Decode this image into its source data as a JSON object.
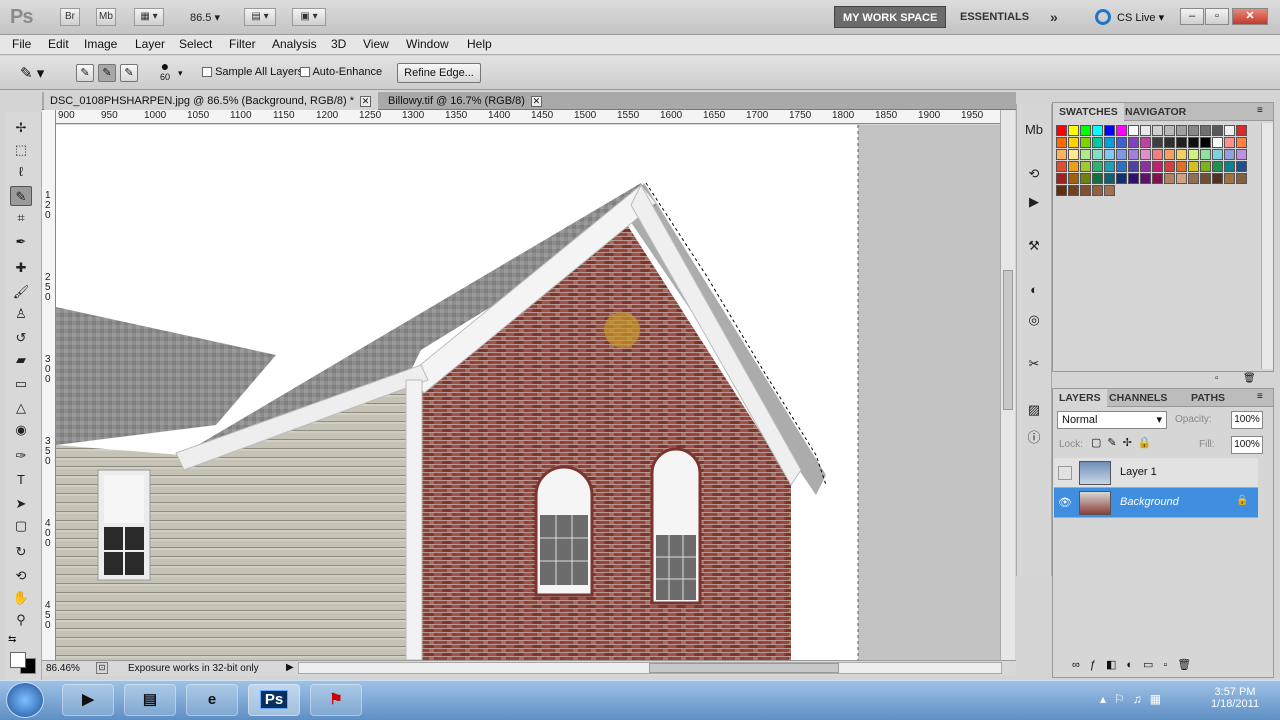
{
  "app": {
    "logo": "Ps",
    "quick_buttons": [
      "Br",
      "Mb"
    ],
    "zoom_value": "86.5",
    "workspaces": [
      "MY WORK SPACE",
      "ESSENTIALS"
    ],
    "more_label": "»",
    "cs_live": "CS Live"
  },
  "menu": [
    "File",
    "Edit",
    "Image",
    "Layer",
    "Select",
    "Filter",
    "Analysis",
    "3D",
    "View",
    "Window",
    "Help"
  ],
  "options": {
    "brush_size": "60",
    "sample_all_layers": "Sample All Layers",
    "auto_enhance": "Auto-Enhance",
    "refine_edge": "Refine Edge..."
  },
  "doc_tabs": [
    {
      "label": "DSC_0108PHSHARPEN.jpg @ 86.5% (Background, RGB/8) *"
    },
    {
      "label": "Billowy.tif @ 16.7% (RGB/8)"
    }
  ],
  "ruler_h": [
    "900",
    "950",
    "1000",
    "1050",
    "1100",
    "1150",
    "1200",
    "1250",
    "1300",
    "1350",
    "1400",
    "1450",
    "1500",
    "1550",
    "1600",
    "1650",
    "1700",
    "1750",
    "1800",
    "1850",
    "1900",
    "1950"
  ],
  "ruler_v": [
    "1",
    "2",
    "0",
    "2",
    "5",
    "0",
    "3",
    "0",
    "0",
    "3",
    "5",
    "0",
    "4",
    "0",
    "0",
    "4",
    "5",
    "0"
  ],
  "status": {
    "zoom": "86.46%",
    "message": "Exposure works in 32-bit only"
  },
  "swatches": {
    "tabs": [
      "SWATCHES",
      "NAVIGATOR"
    ],
    "colors": [
      "#ff0000",
      "#ffff00",
      "#00ff00",
      "#00ffff",
      "#0000ff",
      "#ff00ff",
      "#ffffff",
      "#e8e8e8",
      "#d0d0d0",
      "#b8b8b8",
      "#a0a0a0",
      "#888888",
      "#707070",
      "#585858",
      "#f0f0f0",
      "#d62b2b",
      "#ff6a00",
      "#ffd200",
      "#7fd200",
      "#00c8a0",
      "#00a0e0",
      "#4060d0",
      "#8040c0",
      "#c040a0",
      "#404040",
      "#303030",
      "#202020",
      "#101010",
      "#000000",
      "#f8f8f8",
      "#ff9090",
      "#ff8040",
      "#ffb060",
      "#ffe890",
      "#b0e890",
      "#80e0c0",
      "#80c8f0",
      "#8098e0",
      "#a080d8",
      "#e090c8",
      "#f08080",
      "#f0a060",
      "#f0d060",
      "#d0f080",
      "#90e0a0",
      "#80d0e0",
      "#90a0e0",
      "#c090e0",
      "#e05030",
      "#e8a020",
      "#a0c830",
      "#30b070",
      "#20a0b0",
      "#3070c0",
      "#5040a0",
      "#9030a0",
      "#c02070",
      "#d04040",
      "#e07020",
      "#d0c020",
      "#80b020",
      "#209050",
      "#108090",
      "#205090",
      "#a02020",
      "#a06010",
      "#708010",
      "#107040",
      "#106070",
      "#103070",
      "#301070",
      "#601070",
      "#801050",
      "#b08060",
      "#d0a080",
      "#907050",
      "#705030",
      "#503020",
      "#a07040",
      "#806040",
      "#603010",
      "#704020",
      "#805030",
      "#906040",
      "#a07050"
    ]
  },
  "layers": {
    "tabs": [
      "LAYERS",
      "CHANNELS",
      "PATHS"
    ],
    "blend_mode": "Normal",
    "opacity_label": "Opacity:",
    "opacity_value": "100%",
    "lock_label": "Lock:",
    "fill_label": "Fill:",
    "fill_value": "100%",
    "items": [
      {
        "name": "Layer 1",
        "visible": false
      },
      {
        "name": "Background",
        "visible": true,
        "locked": true
      }
    ]
  },
  "taskbar": {
    "time": "3:57 PM",
    "date": "1/18/2011",
    "apps": [
      "media-player",
      "file-explorer",
      "internet-explorer",
      "Ps",
      "adobe-reader"
    ]
  }
}
